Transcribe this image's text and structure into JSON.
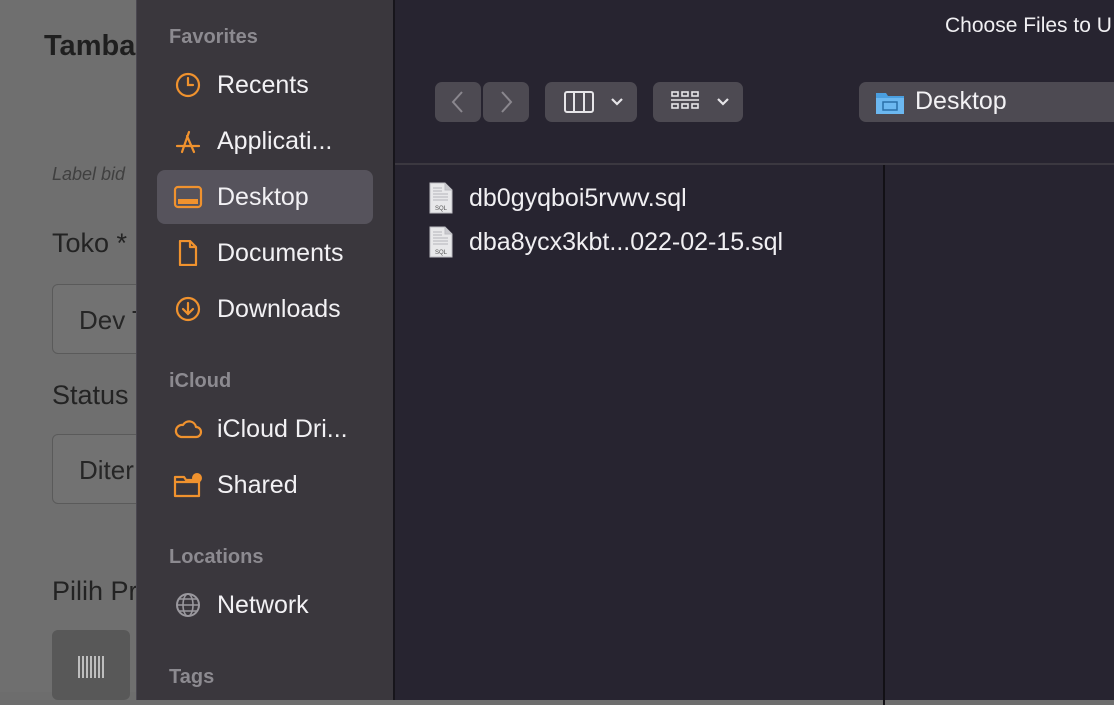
{
  "background_page": {
    "title": "Tamba",
    "hint": "Label bid",
    "fields": [
      {
        "label": "Toko *",
        "value": "Dev T"
      },
      {
        "label": "Status",
        "value": "Diter"
      }
    ],
    "product_label": "Pilih Pr"
  },
  "dialog": {
    "title": "Choose Files to U",
    "sidebar": {
      "sections": [
        {
          "name": "Favorites",
          "items": [
            {
              "label": "Recents",
              "icon": "clock-icon"
            },
            {
              "label": "Applicati...",
              "icon": "applications-icon"
            },
            {
              "label": "Desktop",
              "icon": "desktop-icon",
              "selected": true
            },
            {
              "label": "Documents",
              "icon": "document-icon"
            },
            {
              "label": "Downloads",
              "icon": "download-icon"
            }
          ]
        },
        {
          "name": "iCloud",
          "items": [
            {
              "label": "iCloud Dri...",
              "icon": "cloud-icon"
            },
            {
              "label": "Shared",
              "icon": "shared-folder-icon"
            }
          ]
        },
        {
          "name": "Locations",
          "items": [
            {
              "label": "Network",
              "icon": "globe-icon"
            }
          ]
        },
        {
          "name": "Tags",
          "items": []
        }
      ]
    },
    "toolbar": {
      "back_icon": "chevron-left-icon",
      "forward_icon": "chevron-right-icon",
      "view_icon": "columns-view-icon",
      "group_icon": "grid-group-icon",
      "location": "Desktop"
    },
    "files": [
      {
        "name": "db0gyqboi5rvwv.sql",
        "icon": "sql-file-icon"
      },
      {
        "name": "dba8ycx3kbt...022-02-15.sql",
        "icon": "sql-file-icon"
      }
    ]
  },
  "colors": {
    "accent": "#f0922e",
    "sidebar_bg": "#3a373d",
    "main_bg": "#272430",
    "selection": "#56535c"
  }
}
